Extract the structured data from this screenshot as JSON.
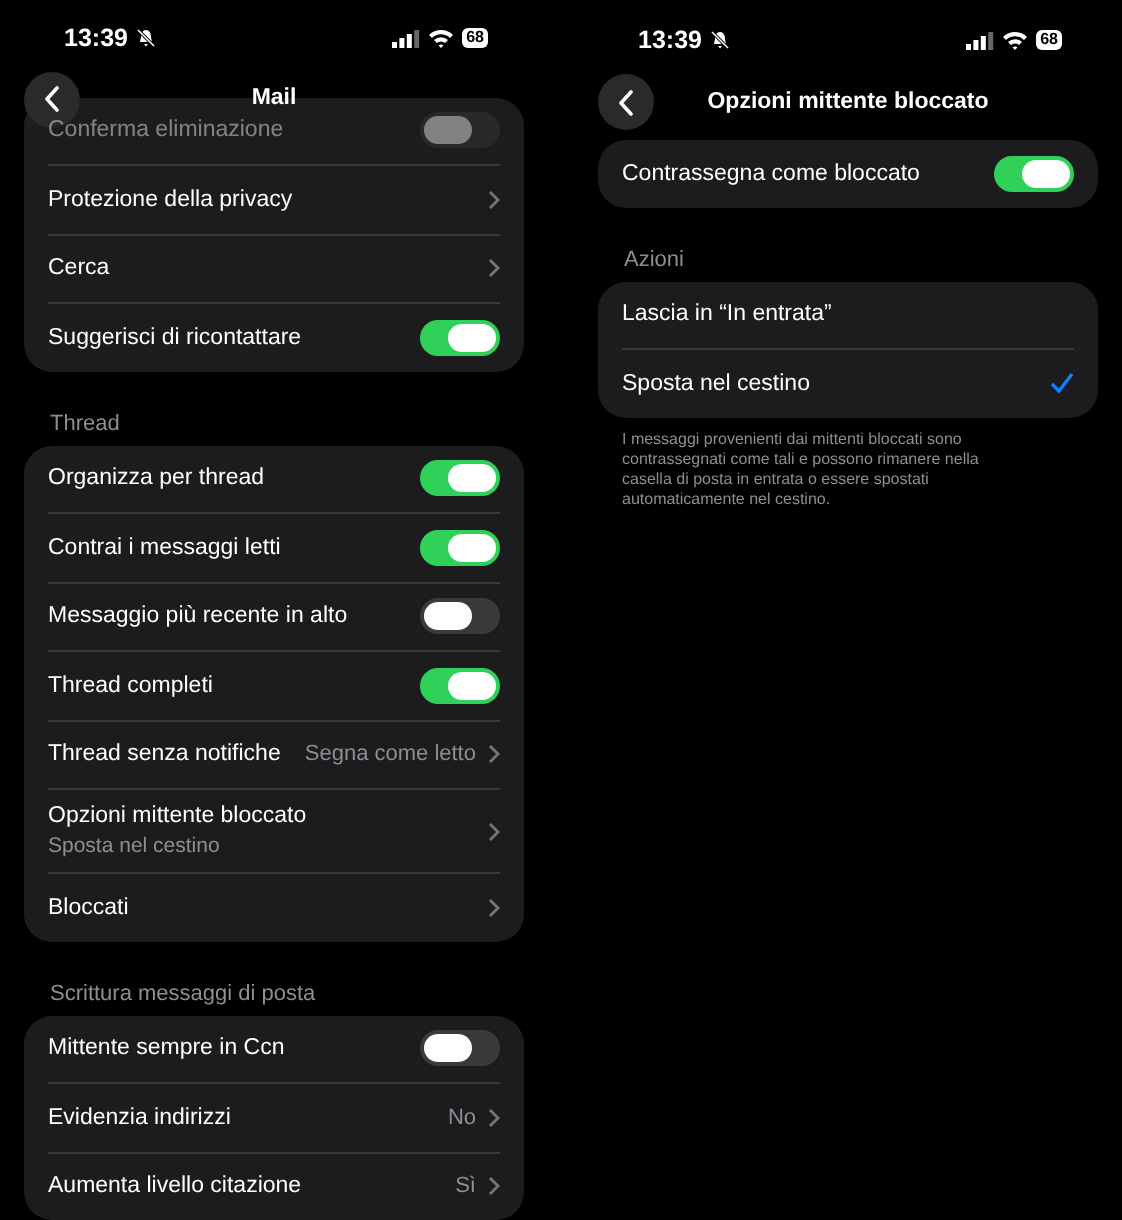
{
  "screens": [
    {
      "status": {
        "time": "13:39",
        "battery": "68"
      },
      "title": "Mail",
      "sections": [
        {
          "rows": [
            {
              "kind": "toggle",
              "label": "Conferma eliminazione",
              "on": false,
              "dimmed": true
            },
            {
              "kind": "link",
              "label": "Protezione della privacy"
            },
            {
              "kind": "link",
              "label": "Cerca"
            },
            {
              "kind": "toggle",
              "label": "Suggerisci di ricontattare",
              "on": true
            }
          ]
        },
        {
          "header": "Thread",
          "rows": [
            {
              "kind": "toggle",
              "label": "Organizza per thread",
              "on": true
            },
            {
              "kind": "toggle",
              "label": "Contrai i messaggi letti",
              "on": true
            },
            {
              "kind": "toggle",
              "label": "Messaggio più recente in alto",
              "on": false
            },
            {
              "kind": "toggle",
              "label": "Thread completi",
              "on": true
            },
            {
              "kind": "link",
              "label": "Thread senza notifiche",
              "value": "Segna come letto"
            },
            {
              "kind": "link",
              "label": "Opzioni mittente bloccato",
              "subtitle": "Sposta nel cestino"
            },
            {
              "kind": "link",
              "label": "Bloccati"
            }
          ]
        },
        {
          "header": "Scrittura messaggi di posta",
          "rows": [
            {
              "kind": "toggle",
              "label": "Mittente sempre in Ccn",
              "on": false
            },
            {
              "kind": "link",
              "label": "Evidenzia indirizzi",
              "value": "No"
            },
            {
              "kind": "link",
              "label": "Aumenta livello citazione",
              "value": "Sì"
            }
          ]
        }
      ]
    },
    {
      "status": {
        "time": "13:39",
        "battery": "68"
      },
      "title": "Opzioni mittente bloccato",
      "sections": [
        {
          "rows": [
            {
              "kind": "toggle",
              "label": "Contrassegna come bloccato",
              "on": true
            }
          ]
        },
        {
          "header": "Azioni",
          "rows": [
            {
              "kind": "choice",
              "label": "Lascia in “In entrata”",
              "selected": false
            },
            {
              "kind": "choice",
              "label": "Sposta nel cestino",
              "selected": true
            }
          ],
          "footer": "I messaggi provenienti dai mittenti bloccati sono contrassegnati come tali e possono rimanere nella casella di posta in entrata o essere spostati automaticamente nel cestino."
        }
      ]
    }
  ]
}
